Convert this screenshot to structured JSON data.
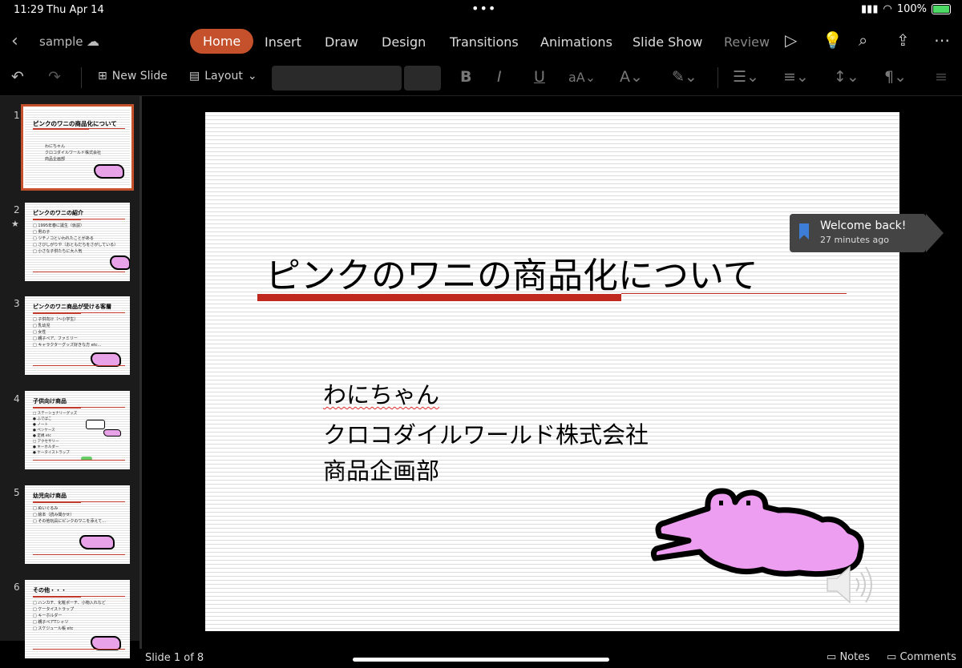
{
  "status_bar": {
    "time": "11:29",
    "date": "Thu Apr 14",
    "dots": "•••",
    "battery": "100%"
  },
  "title_bar": {
    "doc_name": "sample",
    "tabs": [
      {
        "label": "Home",
        "active": true
      },
      {
        "label": "Insert"
      },
      {
        "label": "Draw"
      },
      {
        "label": "Design"
      },
      {
        "label": "Transitions"
      },
      {
        "label": "Animations"
      },
      {
        "label": "Slide Show"
      },
      {
        "label": "Review"
      }
    ]
  },
  "ribbon": {
    "new_slide": "New Slide",
    "layout": "Layout"
  },
  "thumbnails": [
    {
      "num": "1",
      "title": "ピンクのワニの商品化について",
      "lines": [
        "わにちゃん",
        "クロコダイルワールド株式会社",
        "商品企画部"
      ]
    },
    {
      "num": "2",
      "title": "ピンクのワニの紹介",
      "lines": [
        "□ 1995年春に誕生（仮説）",
        "□ 男の子",
        "□ ツチノコといわれたことがある",
        "□ さびしがりや（おともだちをさがしている）",
        "□ 小さな子供たちに大人気"
      ]
    },
    {
      "num": "3",
      "title": "ピンクのワニ商品が受ける客層",
      "lines": [
        "□ 子供向け（〜小学生）",
        "□ 乳幼児",
        "□ 女性",
        "□ 親子ペア、ファミリー",
        "□ キャラクターグッズ好きな方 etc…"
      ]
    },
    {
      "num": "4",
      "title": "子供向け商品",
      "lines": [
        "□ ステーショナリーグッズ",
        "  ● ふでばこ",
        "  ● ノート",
        "  ● ペンケース",
        "  ● 定規 etc",
        "□ アクセサリー",
        "  ● キーホルダー",
        "  ● ケータイストラップ"
      ]
    },
    {
      "num": "5",
      "title": "幼児向け商品",
      "lines": [
        "□ ぬいぐるみ",
        "□ 絵本（読み聞かせ）",
        "□ その他玩具にピンクのワニを添えて…"
      ]
    },
    {
      "num": "6",
      "title": "その他・・・",
      "lines": [
        "□ ハンカチ、化粧ポーチ、小物入れなど",
        "□ ケータイストラップ",
        "□ キーホルダー",
        "□ 親子ペアTシャツ",
        "□ スケジュール帳 etc"
      ]
    }
  ],
  "slide": {
    "title": "ピンクのワニの商品化について",
    "subtitle_lines": [
      "わにちゃん",
      "クロコダイルワールド株式会社",
      "商品企画部"
    ]
  },
  "toast": {
    "title": "Welcome back!",
    "subtitle": "27 minutes ago"
  },
  "footer": {
    "slide_count": "Slide 1 of 8",
    "notes": "Notes",
    "comments": "Comments"
  },
  "colors": {
    "accent": "#c4512b",
    "slide_red": "#c0291e",
    "croc_pink": "#e8a3e8"
  }
}
